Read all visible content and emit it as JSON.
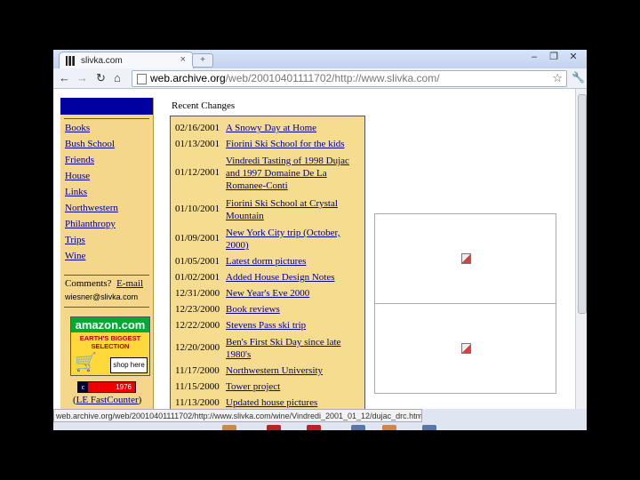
{
  "browser": {
    "tab_title": "slivka.com",
    "tab_close": "×",
    "new_tab": "+",
    "win_controls": [
      "–",
      "❐",
      "✕"
    ],
    "nav": {
      "back": "←",
      "forward": "→",
      "reload": "↻",
      "home": "⌂"
    },
    "url_host": "web.archive.org",
    "url_rest": "/web/20010401111702/http://www.slivka.com/",
    "star": "☆",
    "wrench": "🔧"
  },
  "sidebar": {
    "items": [
      "Books",
      "Bush School",
      "Friends",
      "House",
      "Links",
      "Northwestern",
      "Philanthropy",
      "Trips",
      "Wine"
    ],
    "comments_text": "Comments?",
    "email_link": "E-mail",
    "email_address": "wiesner@slivka.com",
    "amazon_brand": "amazon.com",
    "amazon_tagline": "EARTH'S BIGGEST SELECTION",
    "amazon_shop": "shop here",
    "counter_value": "1976",
    "counter_link_open": "(",
    "counter_link": "LE FastCounter",
    "counter_link_close": ")"
  },
  "recent_changes": {
    "title": "Recent Changes",
    "entries": [
      {
        "date": "02/16/2001",
        "title": "A Snowy Day at Home"
      },
      {
        "date": "01/13/2001",
        "title": "Fiorini Ski School for the kids"
      },
      {
        "date": "01/12/2001",
        "title": "Vindredi Tasting of 1998 Dujac and 1997 Domaine De La Romanee-Conti"
      },
      {
        "date": "01/10/2001",
        "title": "Fiorini Ski School at Crystal Mountain"
      },
      {
        "date": "01/09/2001",
        "title": "New York City trip (October, 2000)"
      },
      {
        "date": "01/05/2001",
        "title": "Latest dorm pictures"
      },
      {
        "date": "01/02/2001",
        "title": "Added House Design Notes"
      },
      {
        "date": "12/31/2000",
        "title": "New Year's Eve 2000"
      },
      {
        "date": "12/23/2000",
        "title": "Book reviews"
      },
      {
        "date": "12/22/2000",
        "title": "Stevens Pass ski trip"
      },
      {
        "date": "12/20/2000",
        "title": "Ben's First Ski Day since late 1980's"
      },
      {
        "date": "11/17/2000",
        "title": "Northwestern University"
      },
      {
        "date": "11/15/2000",
        "title": "Tower project"
      },
      {
        "date": "11/13/2000",
        "title": "Updated house pictures"
      }
    ]
  },
  "status_url": "web.archive.org/web/20010401111702/http://www.slivka.com/wine/Vindredi_2001_01_12/dujac_drc.htm",
  "colors": {
    "sidebar_bg": "#f4d78a",
    "sidebar_header": "#0000a0",
    "link": "#00008b",
    "recent_box_bg": "#f6dc8e"
  }
}
